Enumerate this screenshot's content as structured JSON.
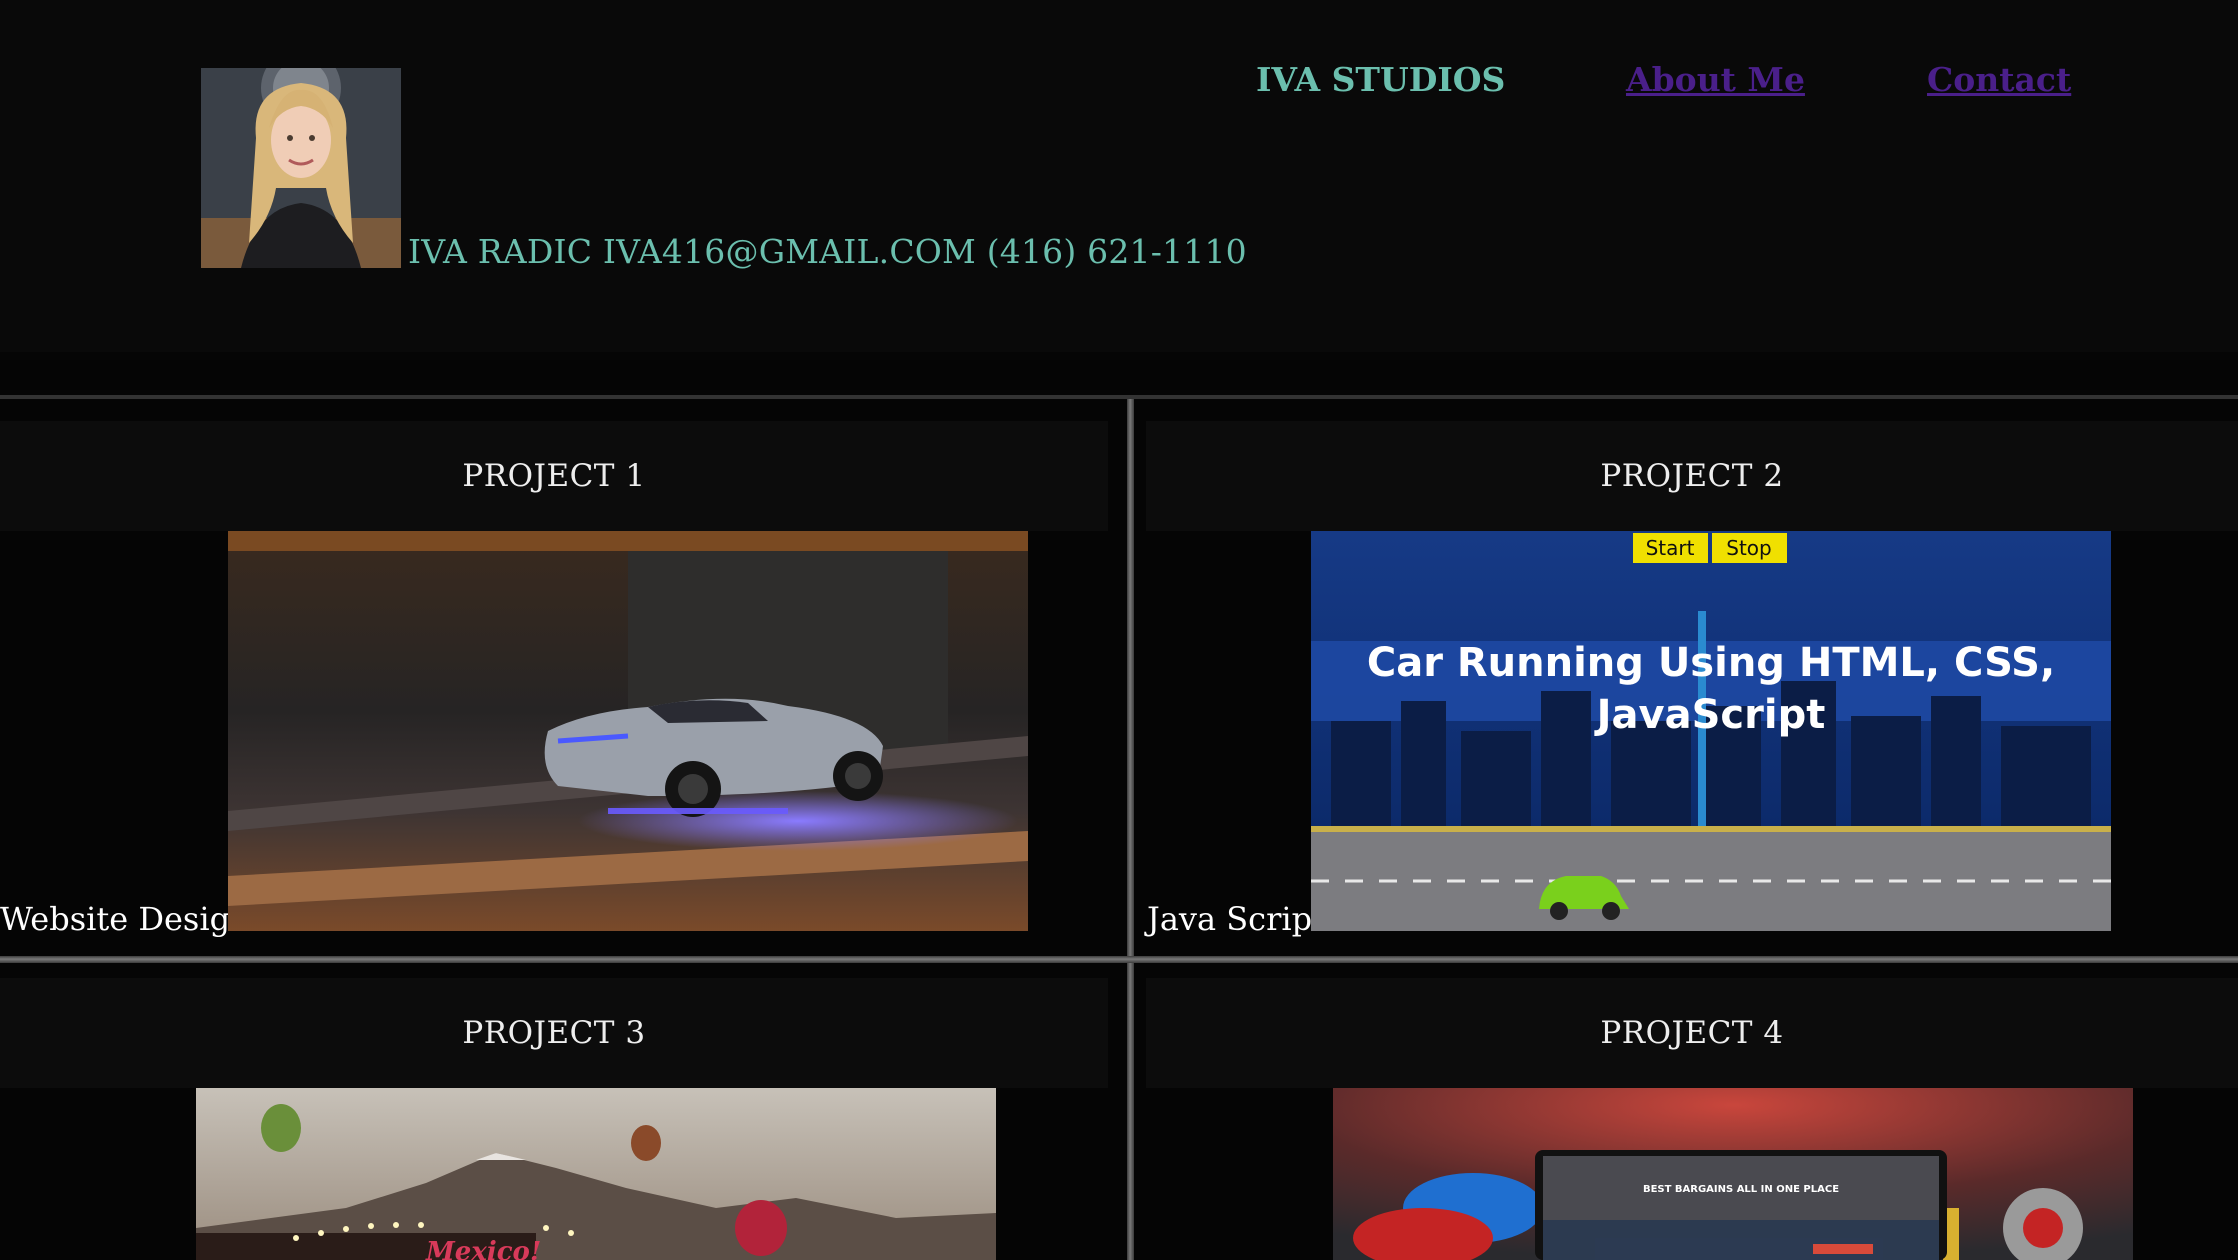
{
  "header": {
    "contact_line": "IVA RADIC IVA416@GMAIL.COM (416) 621-1110",
    "brand": "IVA STUDIOS",
    "nav": {
      "about": "About Me",
      "contact": "Contact"
    },
    "colors": {
      "brand_teal": "#6bbfae",
      "link_purple": "#4a1f8a",
      "background": "#050505"
    }
  },
  "projects": [
    {
      "title": "PROJECT 1",
      "label": "Website Design"
    },
    {
      "title": "PROJECT 2",
      "label": "Java Script",
      "thumb": {
        "start": "Start",
        "stop": "Stop",
        "line1": "Car Running Using HTML, CSS,",
        "line2": "JavaScript"
      }
    },
    {
      "title": "PROJECT 3",
      "thumb": {
        "sign": "Mexico!"
      }
    },
    {
      "title": "PROJECT 4",
      "thumb": {
        "headline": "BEST BARGAINS ALL IN ONE PLACE"
      }
    }
  ]
}
